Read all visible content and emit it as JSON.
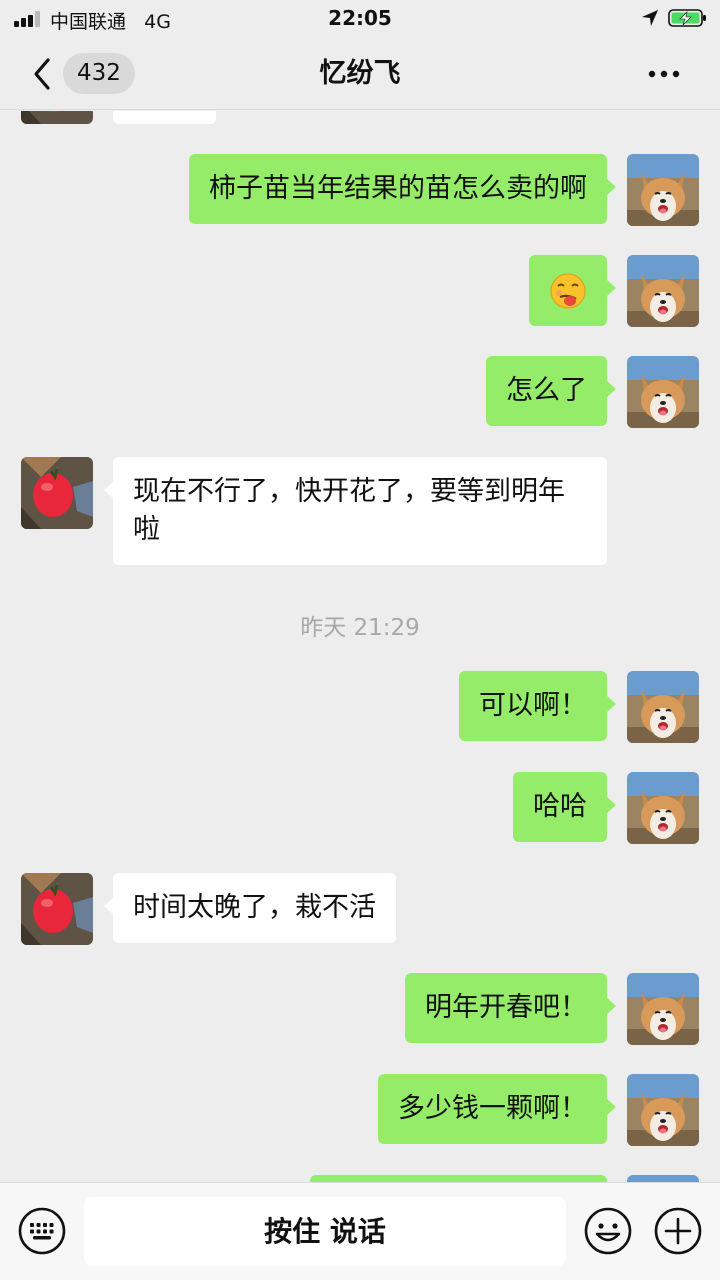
{
  "status_bar": {
    "carrier": "中国联通",
    "network": "4G",
    "time": "22:05",
    "icons": [
      "signal-icon",
      "location-arrow-icon",
      "battery-charging-icon"
    ]
  },
  "nav": {
    "back_icon": "chevron-left-icon",
    "unread_count": "432",
    "title": "忆纷飞",
    "more_icon": "more-dots-icon"
  },
  "messages": [
    {
      "from": "them",
      "text": "",
      "partial": true
    },
    {
      "from": "me",
      "text": "柿子苗当年结果的苗怎么卖的啊"
    },
    {
      "from": "me",
      "type": "emoji",
      "emoji_icon": "smirk-face-emoji-icon"
    },
    {
      "from": "me",
      "text": "怎么了"
    },
    {
      "from": "them",
      "text": "现在不行了，快开花了，要等到明年啦"
    },
    {
      "type": "timestamp",
      "text": "昨天 21:29"
    },
    {
      "from": "me",
      "text": "可以啊！"
    },
    {
      "from": "me",
      "text": "哈哈"
    },
    {
      "from": "them",
      "text": "时间太晚了，栽不活"
    },
    {
      "from": "me",
      "text": "明年开春吧！"
    },
    {
      "from": "me",
      "text": "多少钱一颗啊！"
    },
    {
      "from": "me",
      "text": "",
      "partial": true
    }
  ],
  "input_bar": {
    "keyboard_icon": "keyboard-icon",
    "hold_to_talk": "按住 说话",
    "emoji_icon": "smiley-face-icon",
    "plus_icon": "plus-circle-icon"
  },
  "colors": {
    "background": "#ededed",
    "my_bubble": "#95ec69",
    "their_bubble": "#ffffff",
    "timestamp_text": "#a8a8a8"
  }
}
